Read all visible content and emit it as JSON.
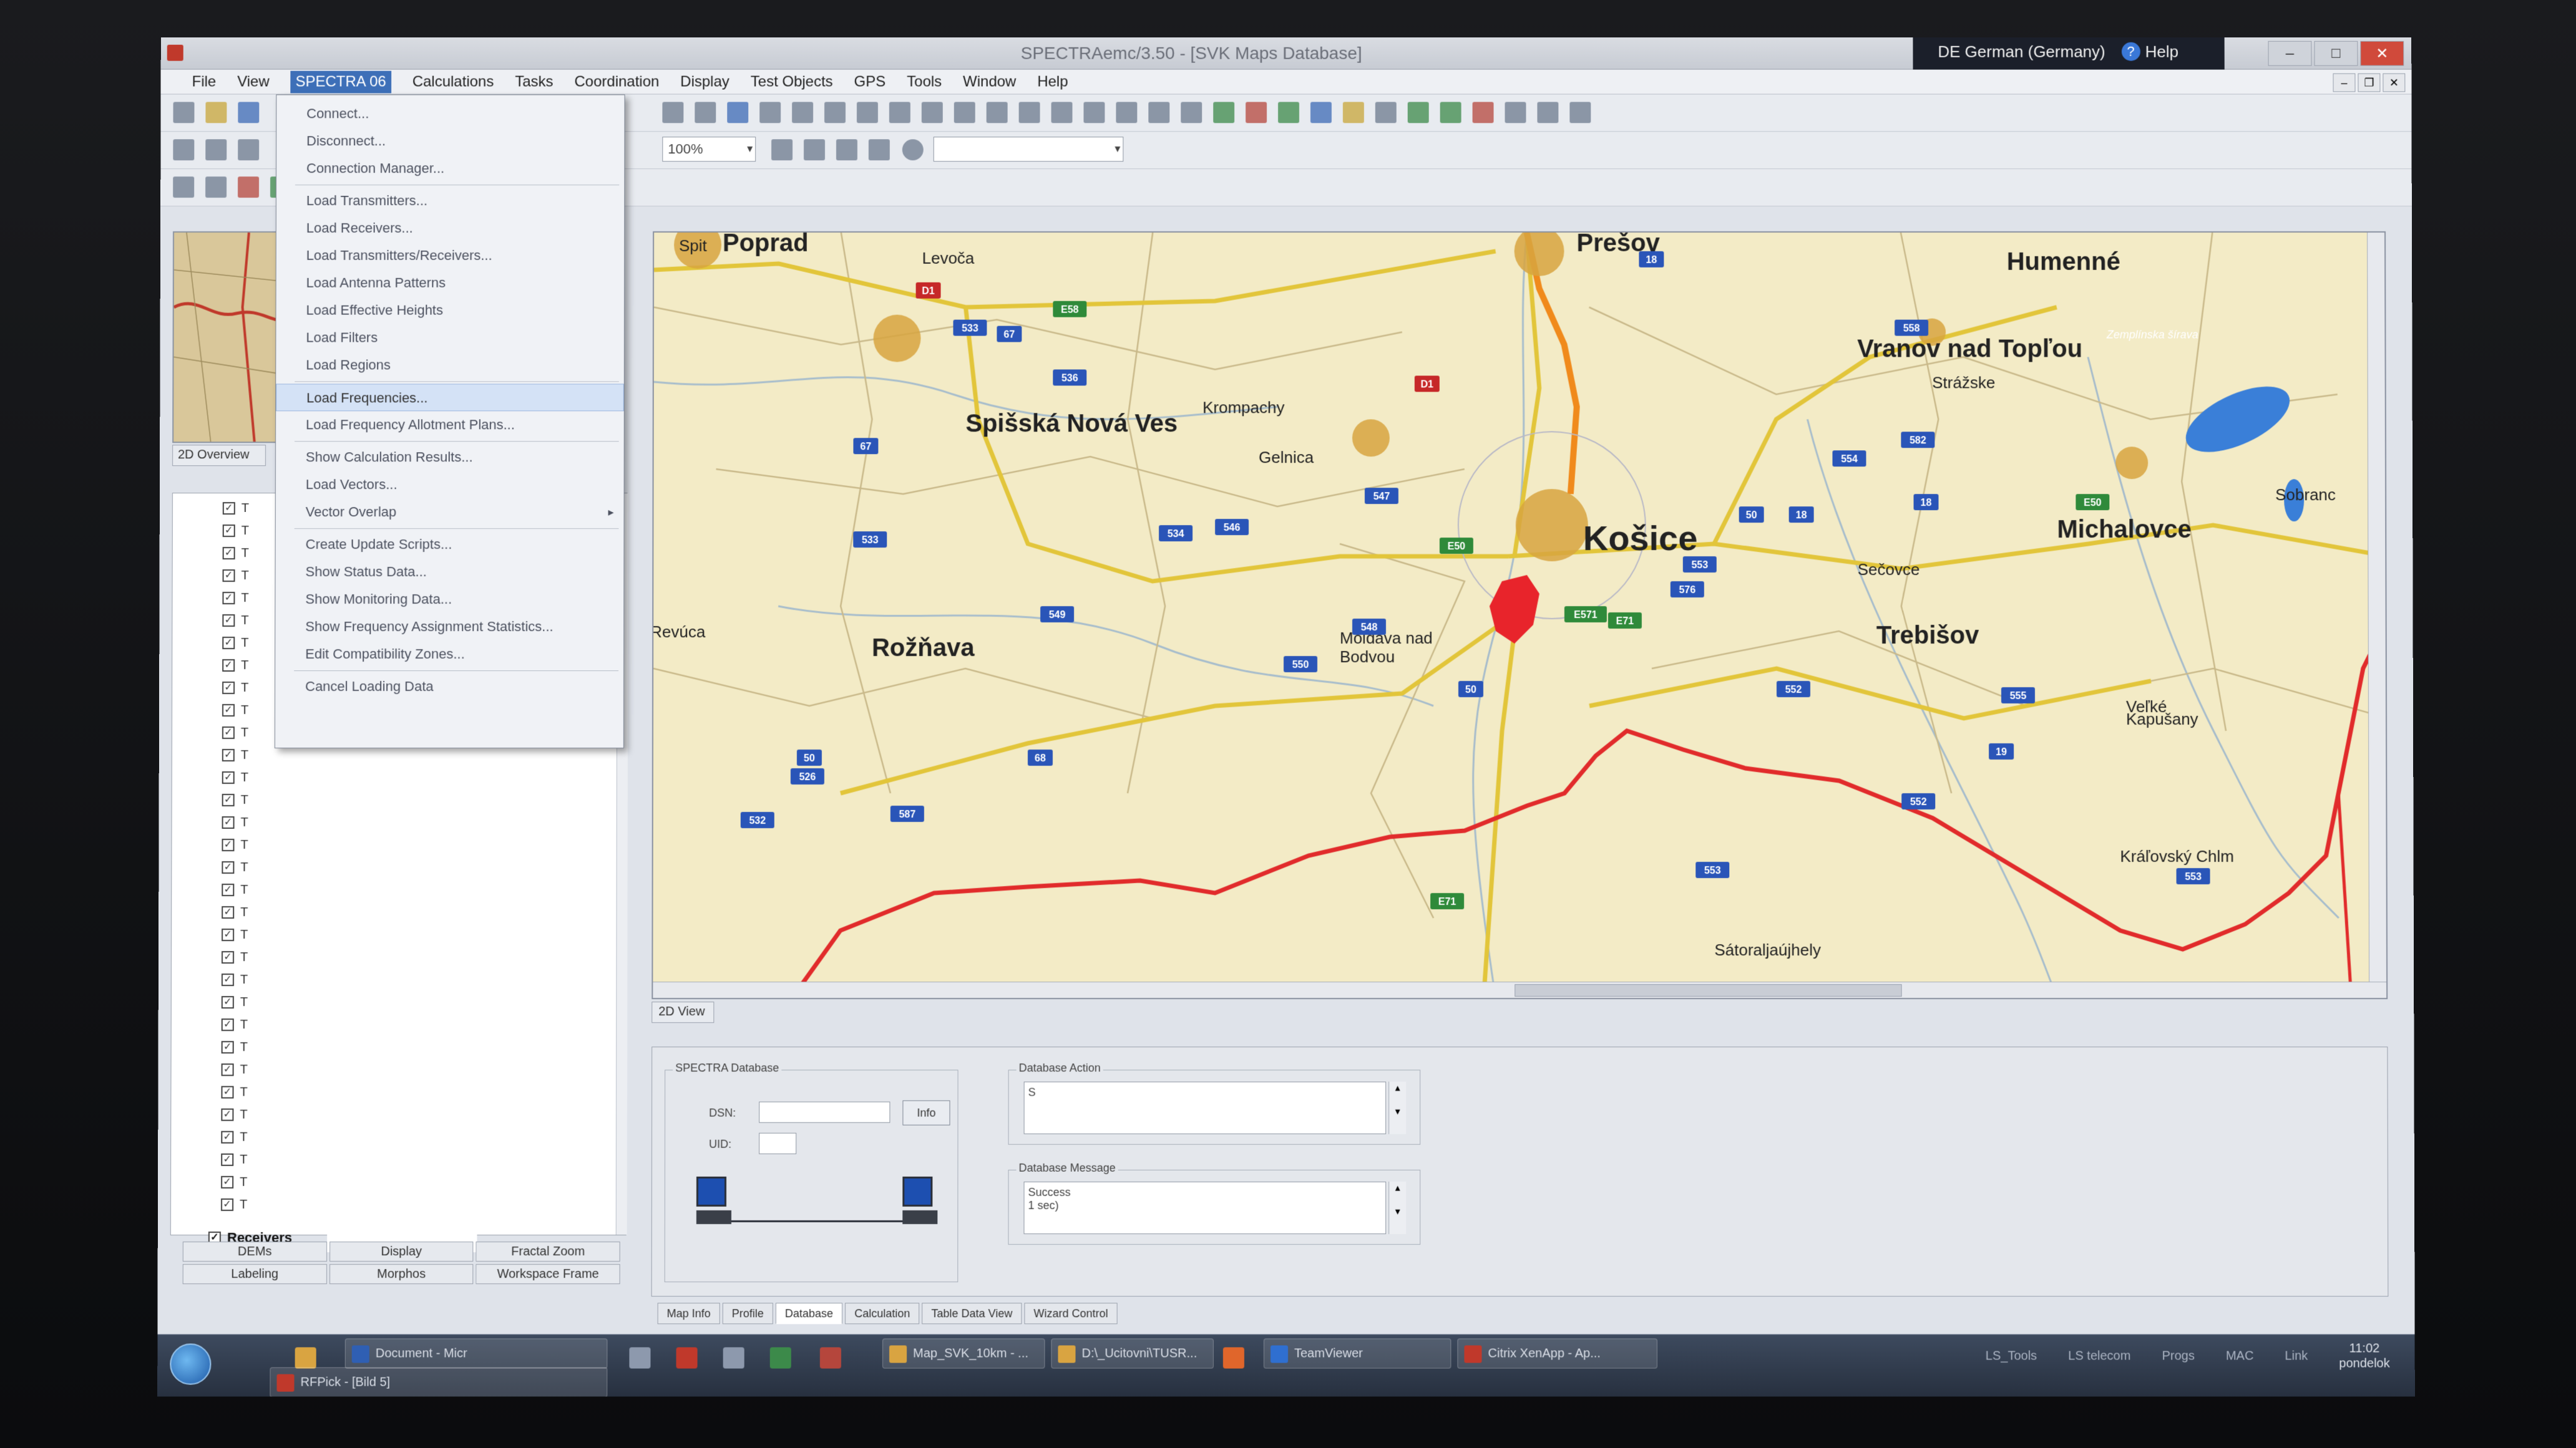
{
  "window": {
    "title": "SPECTRAemc/3.50 - [SVK Maps Database]",
    "language": "DE German (Germany)",
    "help_label": "Help"
  },
  "menubar": [
    "File",
    "View",
    "SPECTRA 06",
    "Calculations",
    "Tasks",
    "Coordination",
    "Display",
    "Test Objects",
    "GPS",
    "Tools",
    "Window",
    "Help"
  ],
  "toolbar": {
    "zoom_value": "100%"
  },
  "dropdown": {
    "items": [
      "Connect...",
      "Disconnect...",
      "Connection Manager...",
      "Load Transmitters...",
      "Load Receivers...",
      "Load Transmitters/Receivers...",
      "Load Antenna Patterns",
      "Load Effective Heights",
      "Load Filters",
      "Load Regions",
      "Load Frequencies...",
      "Load Frequency Allotment Plans...",
      "Show Calculation Results...",
      "Load Vectors...",
      "Vector Overlap",
      "Create Update Scripts...",
      "Show Status Data...",
      "Show Monitoring Data...",
      "Show Frequency Assignment Statistics...",
      "Edit Compatibility Zones...",
      "Cancel Loading Data"
    ]
  },
  "left": {
    "overview_tab": "2D Overview",
    "tree_prefix": "T",
    "receivers_label": "Receivers",
    "tabs": [
      "DEMs",
      "Display",
      "Fractal Zoom",
      "Labeling",
      "Morphos",
      "Workspace Frame"
    ]
  },
  "map": {
    "view_tab": "2D View",
    "cities": [
      {
        "name": "Poprad",
        "big": true
      },
      {
        "name": "Prešov",
        "big": true
      },
      {
        "name": "Humenné",
        "big": true
      },
      {
        "name": "Levoča",
        "big": false
      },
      {
        "name": "Spišská Nová Ves",
        "big": true
      },
      {
        "name": "Krompachy",
        "big": false
      },
      {
        "name": "Gelnica",
        "big": false
      },
      {
        "name": "Vranov nad Topľou",
        "big": true
      },
      {
        "name": "Strážske",
        "big": false
      },
      {
        "name": "Michalovce",
        "big": true
      },
      {
        "name": "Sobranc",
        "big": false
      },
      {
        "name": "Košice",
        "big": true
      },
      {
        "name": "Sečovce",
        "big": false
      },
      {
        "name": "Rožňava",
        "big": true
      },
      {
        "name": "Revúca",
        "big": false
      },
      {
        "name": "Moldava nad",
        "big": false
      },
      {
        "name": "Bodvou",
        "big": false
      },
      {
        "name": "Trebišov",
        "big": true
      },
      {
        "name": "Veľké",
        "big": false
      },
      {
        "name": "Kapušany",
        "big": false
      },
      {
        "name": "Kráľovský Chlm",
        "big": false
      },
      {
        "name": "Sátoraljaújhely",
        "big": false
      },
      {
        "name": "Spit",
        "big": false
      },
      {
        "name": "Zemplínska šírava",
        "big": false
      }
    ],
    "road_labels": [
      "D1",
      "D1",
      "E50",
      "E50",
      "E58",
      "E71",
      "E71",
      "E571",
      "18",
      "18",
      "533",
      "536",
      "534",
      "547",
      "546",
      "533",
      "67",
      "549",
      "550",
      "548",
      "576",
      "552",
      "50",
      "526",
      "532",
      "587",
      "50",
      "68",
      "50",
      "553",
      "554",
      "558",
      "582",
      "555",
      "554",
      "18",
      "19",
      "552",
      "553",
      "553",
      "67"
    ]
  },
  "db": {
    "group_title": "SPECTRA Database",
    "dsn_label": "DSN:",
    "uid_label": "UID:",
    "info_button": "Info",
    "action_title": "Database Action",
    "action_text": "S",
    "message_title": "Database Message",
    "message_line1": "Success",
    "message_line2": "1 sec)"
  },
  "bottom_tabs": [
    "Map Info",
    "Profile",
    "Database",
    "Calculation",
    "Table Data View",
    "Wizard Control"
  ],
  "taskbar": {
    "buttons": [
      "Document - Micr",
      "RFPick - [Bild 5]",
      "Map_SVK_10km - ...",
      "D:\\_Ucitovni\\TUSR...",
      "TeamViewer",
      "Citrix XenApp - Ap..."
    ],
    "tray_items": [
      "LS_Tools",
      "LS telecom",
      "Progs",
      "MAC",
      "Link"
    ],
    "clock": "11:02",
    "day": "pondelok"
  }
}
